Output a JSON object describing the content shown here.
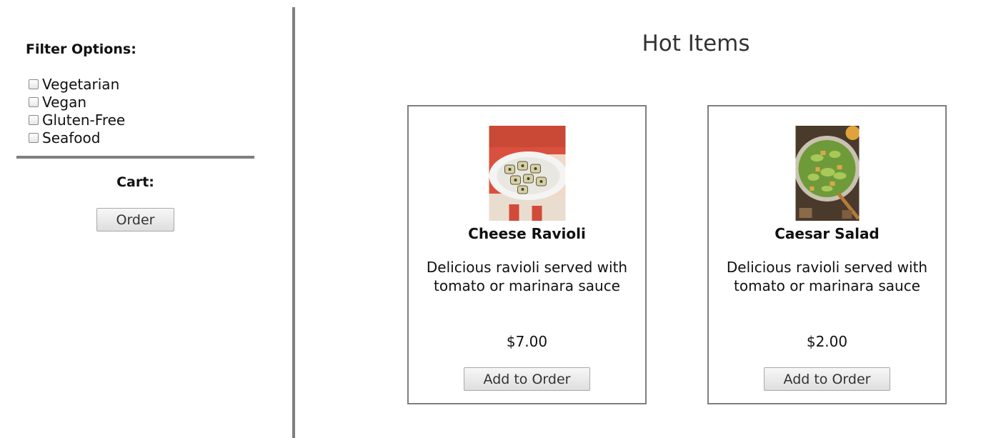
{
  "sidebar": {
    "filter_title": "Filter Options:",
    "filters": [
      {
        "label": "Vegetarian",
        "checked": false
      },
      {
        "label": "Vegan",
        "checked": false
      },
      {
        "label": "Gluten-Free",
        "checked": false
      },
      {
        "label": "Seafood",
        "checked": false
      }
    ],
    "cart_title": "Cart:",
    "order_label": "Order"
  },
  "main": {
    "title": "Hot Items",
    "items": [
      {
        "name": "Cheese Ravioli",
        "description": "Delicious ravioli served with tomato or marinara sauce",
        "price": "$7.00",
        "button_label": "Add to Order",
        "image_icon": "ravioli-photo"
      },
      {
        "name": "Caesar Salad",
        "description": "Delicious ravioli served with tomato or marinara sauce",
        "price": "$2.00",
        "button_label": "Add to Order",
        "image_icon": "salad-photo"
      }
    ]
  },
  "colors": {
    "divider": "#7f7f7f",
    "card_border": "#7f7f7f"
  }
}
